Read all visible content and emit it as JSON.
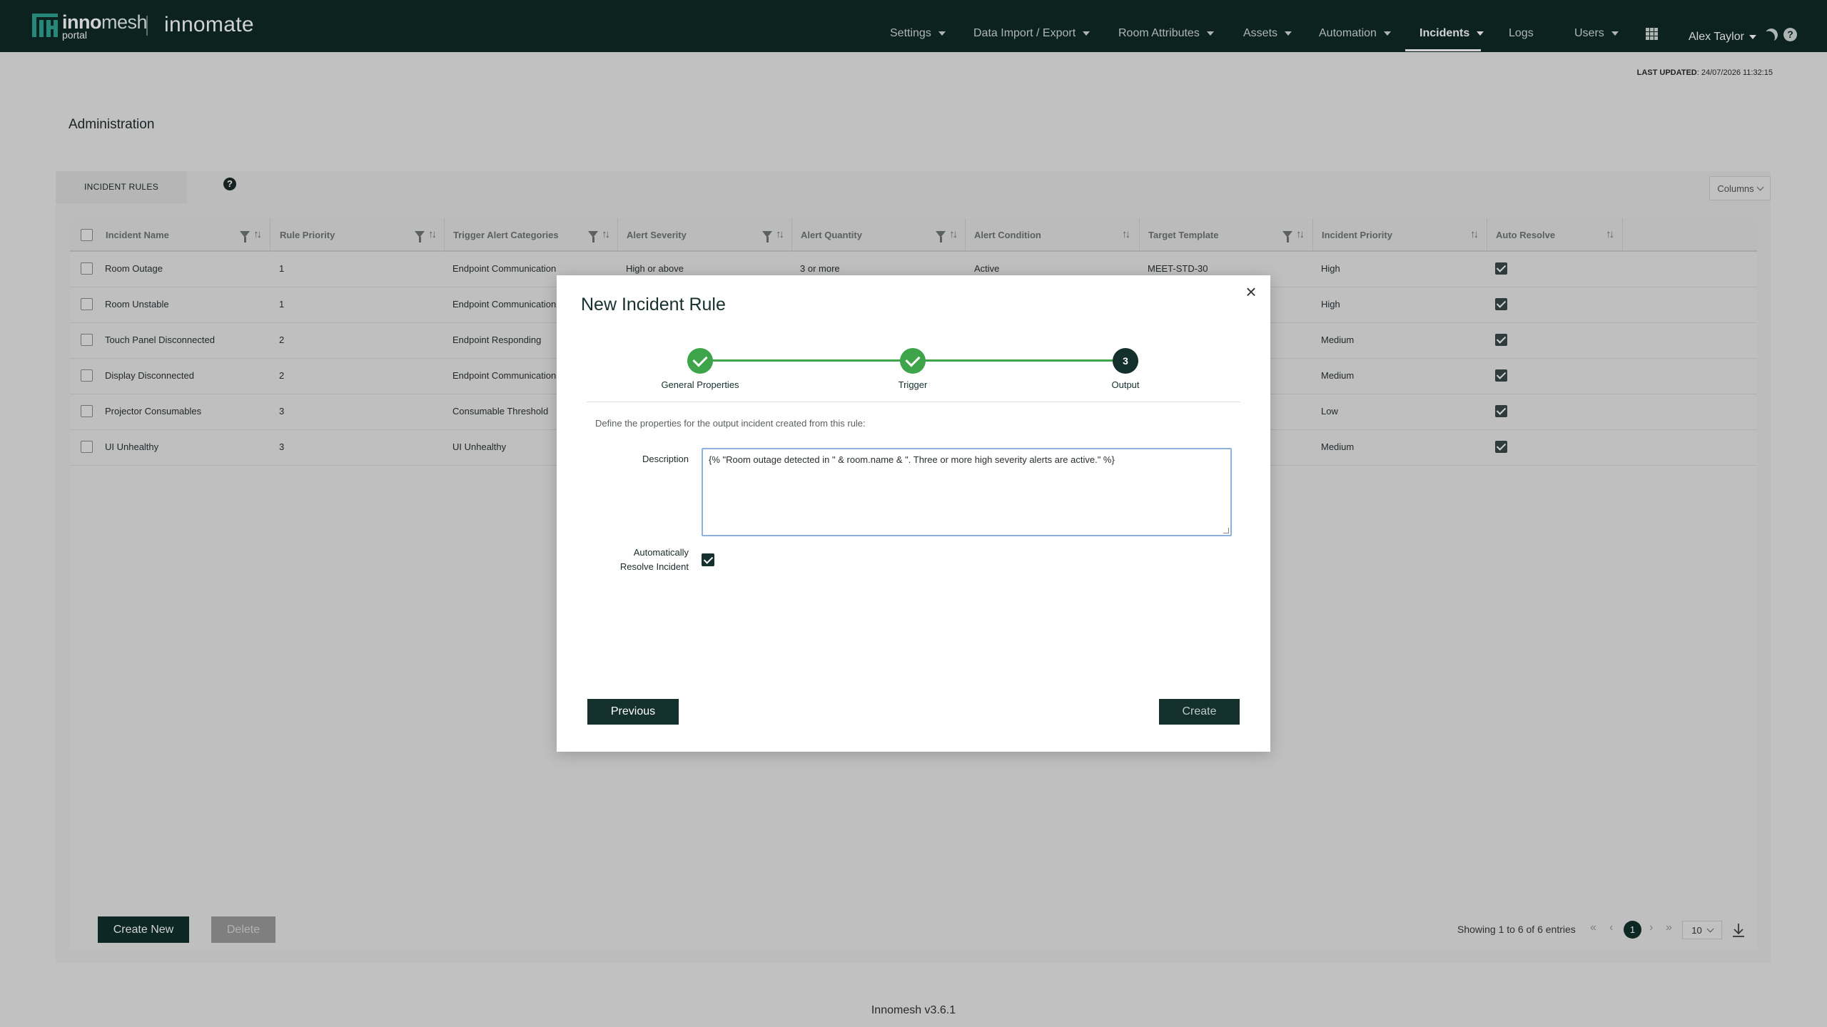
{
  "brand": {
    "name_part1": "inno",
    "name_part2": "mesh",
    "sub": "portal",
    "product": "innomate"
  },
  "nav": [
    {
      "label": "Settings",
      "has_caret": true
    },
    {
      "label": "Data Import / Export",
      "has_caret": true
    },
    {
      "label": "Room Attributes",
      "has_caret": true
    },
    {
      "label": "Assets",
      "has_caret": true
    },
    {
      "label": "Automation",
      "has_caret": true
    },
    {
      "label": "Incidents",
      "has_caret": true,
      "active": true
    },
    {
      "label": "Logs",
      "has_caret": false
    },
    {
      "label": "Users",
      "has_caret": true
    }
  ],
  "user": {
    "name": "Alex Taylor"
  },
  "last_updated": {
    "label": "LAST UPDATED",
    "value": ": 24/07/2026 11:32:15"
  },
  "page_title": "Administration",
  "panel": {
    "tab": "INCIDENT RULES",
    "columns_button": "Columns"
  },
  "table": {
    "headers": [
      "Incident Name",
      "Rule Priority",
      "Trigger Alert Categories",
      "Alert Severity",
      "Alert Quantity",
      "Alert Condition",
      "Target Template",
      "Incident Priority",
      "Auto Resolve"
    ],
    "rows": [
      {
        "name": "Room Outage",
        "priority": "1",
        "categories": "Endpoint Communication",
        "severity": "High or above",
        "quantity": "3 or more",
        "condition": "Active",
        "template": "MEET-STD-30",
        "incident_priority": "High",
        "auto_resolve": true
      },
      {
        "name": "Room Unstable",
        "priority": "1",
        "categories": "Endpoint Communication",
        "severity": "",
        "quantity": "",
        "condition": "",
        "template": "",
        "incident_priority": "High",
        "auto_resolve": true
      },
      {
        "name": "Touch Panel Disconnected",
        "priority": "2",
        "categories": "Endpoint Responding",
        "severity": "",
        "quantity": "",
        "condition": "",
        "template": "",
        "incident_priority": "Medium",
        "auto_resolve": true
      },
      {
        "name": "Display Disconnected",
        "priority": "2",
        "categories": "Endpoint Communication",
        "severity": "",
        "quantity": "",
        "condition": "",
        "template": "",
        "incident_priority": "Medium",
        "auto_resolve": true
      },
      {
        "name": "Projector Consumables",
        "priority": "3",
        "categories": "Consumable Threshold",
        "severity": "",
        "quantity": "",
        "condition": "",
        "template": "",
        "incident_priority": "Low",
        "auto_resolve": true
      },
      {
        "name": "UI Unhealthy",
        "priority": "3",
        "categories": "UI Unhealthy",
        "severity": "",
        "quantity": "",
        "condition": "",
        "template": "",
        "incident_priority": "Medium",
        "auto_resolve": true
      }
    ]
  },
  "actions": {
    "create_new": "Create New",
    "delete": "Delete"
  },
  "pagination": {
    "showing": "Showing 1 to 6 of 6 entries",
    "current_page": "1",
    "page_size": "10",
    "first": "«",
    "prev": "‹",
    "next": "›",
    "last": "»"
  },
  "footer": {
    "version": "Innomesh v3.6.1"
  },
  "modal": {
    "title": "New Incident Rule",
    "close": "×",
    "steps": [
      {
        "label": "General Properties",
        "status": "done"
      },
      {
        "label": "Trigger",
        "status": "done"
      },
      {
        "label": "Output",
        "status": "current",
        "number": "3"
      }
    ],
    "intro": "Define the properties for the output incident created from this rule:",
    "description_label": "Description",
    "description_value": "{% \"Room outage detected in \" & room.name & \". Three or more high severity alerts are active.\" %}",
    "auto_resolve_label_1": "Automatically",
    "auto_resolve_label_2": "Resolve Incident",
    "auto_resolve_checked": true,
    "previous": "Previous",
    "create": "Create"
  },
  "colors": {
    "nav_bg": "#0f2a27",
    "brand_accent": "#2fa597",
    "primary_button": "#13302c",
    "step_done": "#3ea44a"
  }
}
